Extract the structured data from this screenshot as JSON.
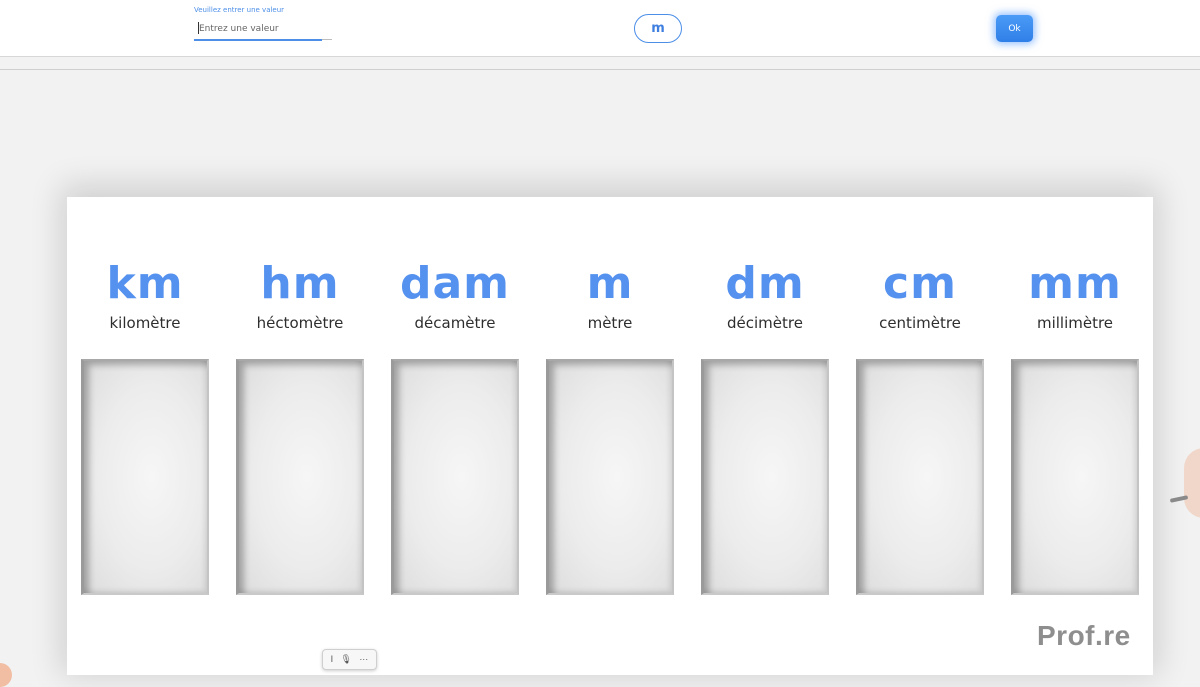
{
  "toolbar": {
    "field_label": "Veuillez entrer une valeur",
    "input_placeholder": "Entrez une valeur",
    "input_value": "",
    "unit_button_label": "m",
    "ok_button_label": "Ok"
  },
  "board": {
    "units": [
      {
        "symbol": "km",
        "name": "kilomètre"
      },
      {
        "symbol": "hm",
        "name": "héctomètre"
      },
      {
        "symbol": "dam",
        "name": "décamètre"
      },
      {
        "symbol": "m",
        "name": "mètre"
      },
      {
        "symbol": "dm",
        "name": "décimètre"
      },
      {
        "symbol": "cm",
        "name": "centimètre"
      },
      {
        "symbol": "mm",
        "name": "millimètre"
      }
    ],
    "brand": "Prof.re"
  },
  "mini_toolbar": {
    "items": [
      {
        "icon": "cursor-icon",
        "glyph": "I"
      },
      {
        "icon": "microphone-icon",
        "glyph": "🎙"
      },
      {
        "icon": "more-icon",
        "glyph": "···"
      }
    ]
  },
  "colors": {
    "accent": "#4d8fe8",
    "unit_symbol": "#5591ee",
    "brand_text": "#8e8e8e"
  }
}
